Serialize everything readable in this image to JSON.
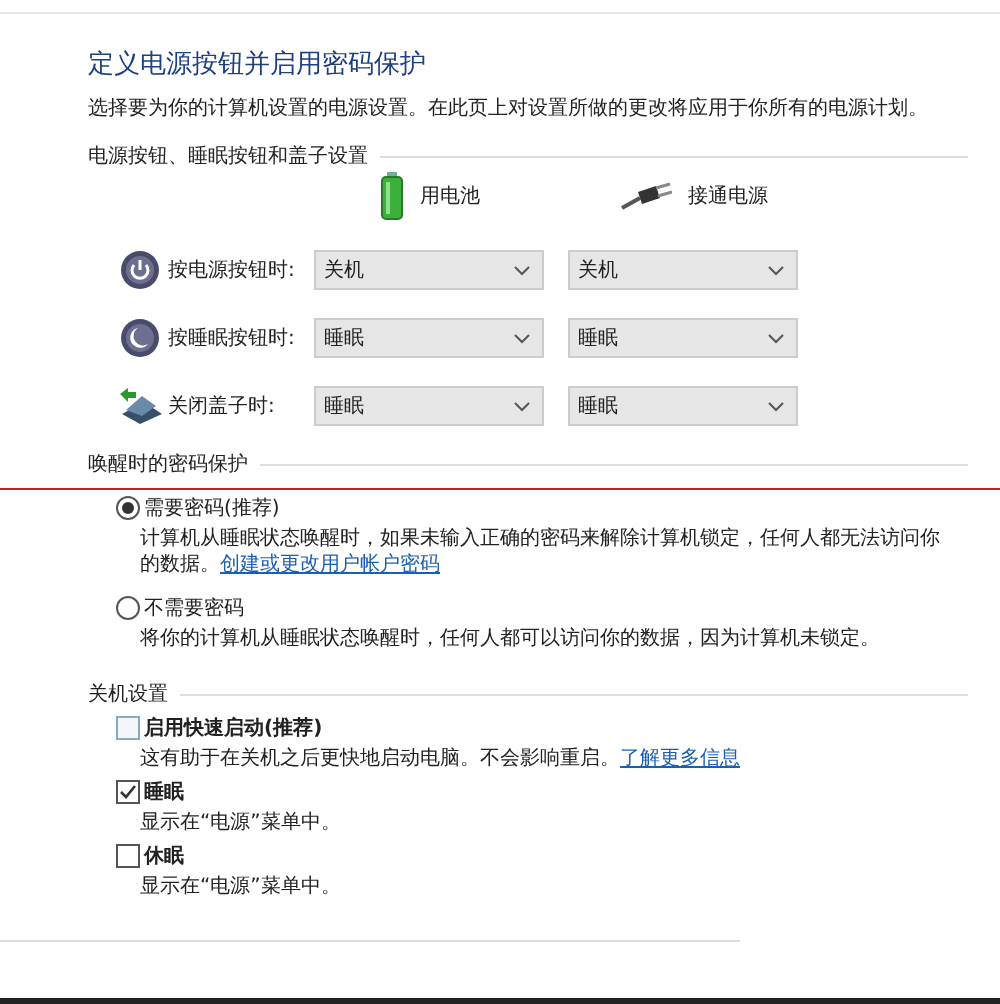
{
  "title": "定义电源按钮并启用密码保护",
  "description": "选择要为你的计算机设置的电源设置。在此页上对设置所做的更改将应用于你所有的电源计划。",
  "power_section": {
    "heading": "电源按钮、睡眠按钮和盖子设置",
    "columns": [
      {
        "label": "用电池",
        "kind": "battery"
      },
      {
        "label": "接通电源",
        "kind": "plug"
      }
    ],
    "rows": [
      {
        "kind": "power",
        "label": "按电源按钮时:",
        "values": [
          "关机",
          "关机"
        ]
      },
      {
        "kind": "sleep",
        "label": "按睡眠按钮时:",
        "values": [
          "睡眠",
          "睡眠"
        ]
      },
      {
        "kind": "lid",
        "label": "关闭盖子时:",
        "values": [
          "睡眠",
          "睡眠"
        ]
      }
    ]
  },
  "password_section": {
    "heading": "唤醒时的密码保护",
    "options": [
      {
        "label": "需要密码(推荐)",
        "selected": true,
        "description": "计算机从睡眠状态唤醒时，如果未输入正确的密码来解除计算机锁定，任何人都无法访问你的数据。",
        "link": "创建或更改用户帐户密码"
      },
      {
        "label": "不需要密码",
        "selected": false,
        "description": "将你的计算机从睡眠状态唤醒时，任何人都可以访问你的数据，因为计算机未锁定。"
      }
    ]
  },
  "shutdown_section": {
    "heading": "关机设置",
    "options": [
      {
        "label": "启用快速启动(推荐)",
        "checked": false,
        "disabled": true,
        "description": "这有助于在关机之后更快地启动电脑。不会影响重启。",
        "link": "了解更多信息"
      },
      {
        "label": "睡眠",
        "checked": true,
        "disabled": false,
        "description": "显示在“电源”菜单中。"
      },
      {
        "label": "休眠",
        "checked": false,
        "disabled": false,
        "description": "显示在“电源”菜单中。"
      }
    ]
  }
}
